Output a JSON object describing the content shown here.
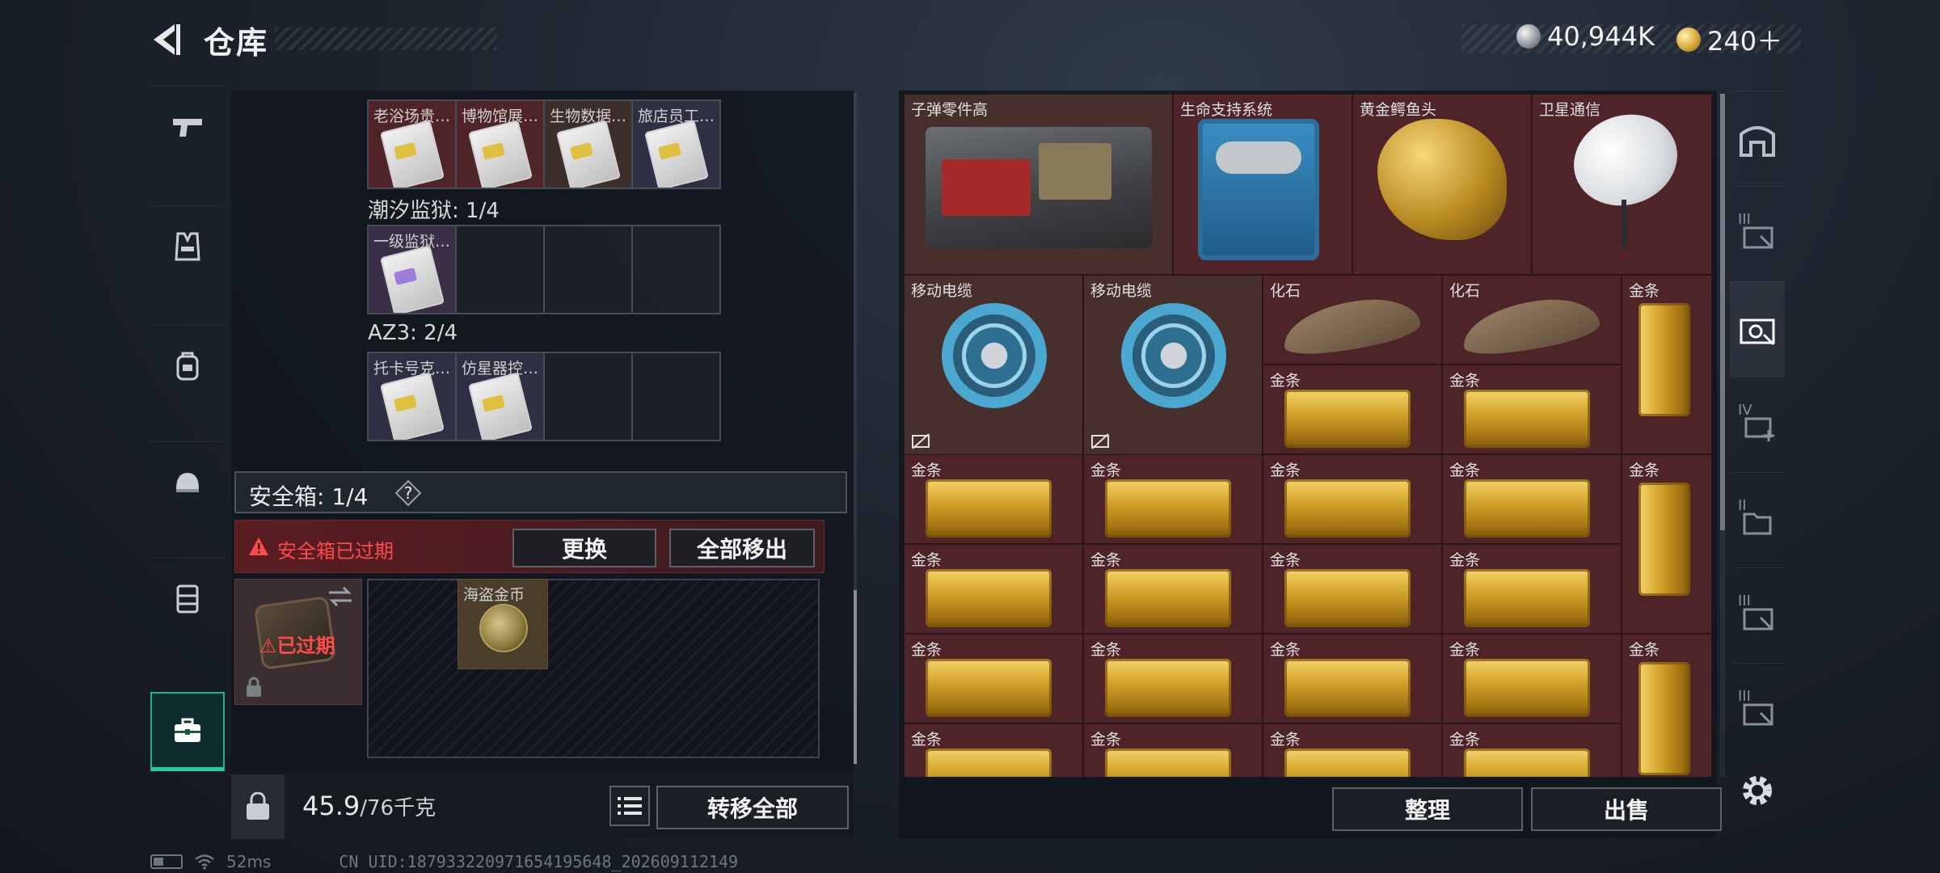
{
  "header": {
    "title": "仓库",
    "currency_silver": "40,944K",
    "currency_gold": "240＋"
  },
  "left_rail": {
    "items": [
      {
        "name": "weapon",
        "icon": "pistol-icon"
      },
      {
        "name": "armor",
        "icon": "vest-icon"
      },
      {
        "name": "backpack",
        "icon": "backpack-icon"
      },
      {
        "name": "helmet",
        "icon": "helmet-icon"
      },
      {
        "name": "chest-rig",
        "icon": "rig-icon"
      },
      {
        "name": "case",
        "icon": "briefcase-icon",
        "active": true
      }
    ]
  },
  "keycards": {
    "row1": [
      "老浴场贵…",
      "博物馆展…",
      "生物数据…",
      "旅店员工…"
    ],
    "section_prison": "潮汐监狱: 1/4",
    "row2": [
      "一级监狱…"
    ],
    "section_az3": "AZ3: 2/4",
    "row3": [
      "托卡号克…",
      "仿星器控…"
    ]
  },
  "safebox": {
    "title": "安全箱: 1/4",
    "help": "?",
    "expired_notice": "安全箱已过期",
    "replace_button": "更换",
    "remove_all_button": "全部移出",
    "expired_badge": "已过期",
    "pirate_coin_label": "海盗金币"
  },
  "weight": {
    "current": "45.9",
    "max": "/76千克",
    "transfer_all_button": "转移全部"
  },
  "stash": {
    "items": [
      {
        "label": "子弹零件高",
        "kind": "ammo-parts"
      },
      {
        "label": "生命支持系统",
        "kind": "life-support"
      },
      {
        "label": "黄金鳄鱼头",
        "kind": "gold-croc-head"
      },
      {
        "label": "卫星通信",
        "kind": "satellite"
      },
      {
        "label": "移动电缆",
        "kind": "cable-reel"
      },
      {
        "label": "移动电缆",
        "kind": "cable-reel"
      },
      {
        "label": "化石",
        "kind": "fossil"
      },
      {
        "label": "化石",
        "kind": "fossil"
      },
      {
        "label": "金条",
        "kind": "gold-bar"
      }
    ],
    "gold_bar_label": "金条",
    "organize_button": "整理",
    "sell_button": "出售"
  },
  "right_rail": {
    "tabs": [
      {
        "icon": "vault-icon",
        "tier": ""
      },
      {
        "icon": "case-tier-icon",
        "tier": "III"
      },
      {
        "icon": "case-active-icon",
        "tier": ""
      },
      {
        "icon": "medkit-case-icon",
        "tier": "IV"
      },
      {
        "icon": "folder-case-icon",
        "tier": "II"
      },
      {
        "icon": "case-tier-icon",
        "tier": "III"
      },
      {
        "icon": "case-tier-icon",
        "tier": "III"
      }
    ]
  },
  "status": {
    "ping": "52ms",
    "uid": "CN UID:18793322097165419564​8_202609112149"
  }
}
